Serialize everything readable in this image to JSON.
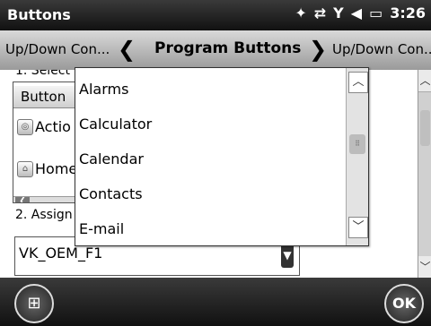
{
  "status_bar": {
    "title": "Buttons",
    "time": "3:26",
    "icons": [
      "signal-icon",
      "sync-icon",
      "no-signal-icon",
      "speaker-icon",
      "battery-icon"
    ]
  },
  "tabs": {
    "prev": "Up/Down Con...",
    "current": "Program Buttons",
    "next": "Up/Down Con..."
  },
  "section1_label": "1. Select",
  "button_list": {
    "header": "Button",
    "items": [
      "Actio",
      "Home"
    ]
  },
  "section2_label": "2. Assign",
  "assign_value": "VK_OEM_F1",
  "dropdown": {
    "items": [
      "Alarms",
      "Calculator",
      "Calendar",
      "Contacts",
      "E-mail"
    ]
  },
  "bottom_bar": {
    "ok_label": "OK"
  }
}
